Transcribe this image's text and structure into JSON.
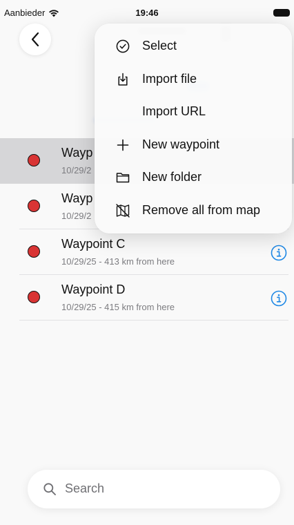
{
  "status_bar": {
    "carrier": "Aanbieder",
    "time": "19:46"
  },
  "menu": {
    "items": [
      {
        "label": "Select",
        "icon": "checkmark-circle-icon"
      },
      {
        "label": "Import file",
        "icon": "import-file-icon"
      },
      {
        "label": "Import URL",
        "icon": ""
      },
      {
        "label": "New waypoint",
        "icon": "plus-icon"
      },
      {
        "label": "New folder",
        "icon": "folder-icon"
      },
      {
        "label": "Remove all from map",
        "icon": "map-slash-icon"
      }
    ]
  },
  "waypoints": [
    {
      "name": "Wayp",
      "meta": "10/29/2"
    },
    {
      "name": "Wayp",
      "meta": "10/29/2"
    },
    {
      "name": "Waypoint C",
      "meta": "10/29/25 - 413 km from here"
    },
    {
      "name": "Waypoint D",
      "meta": "10/29/25 - 415 km from here"
    }
  ],
  "search": {
    "placeholder": "Search"
  },
  "colors": {
    "accent": "#1e88e5",
    "waypoint_dot": "#d93434",
    "selected_row": "#d6d6d8"
  }
}
